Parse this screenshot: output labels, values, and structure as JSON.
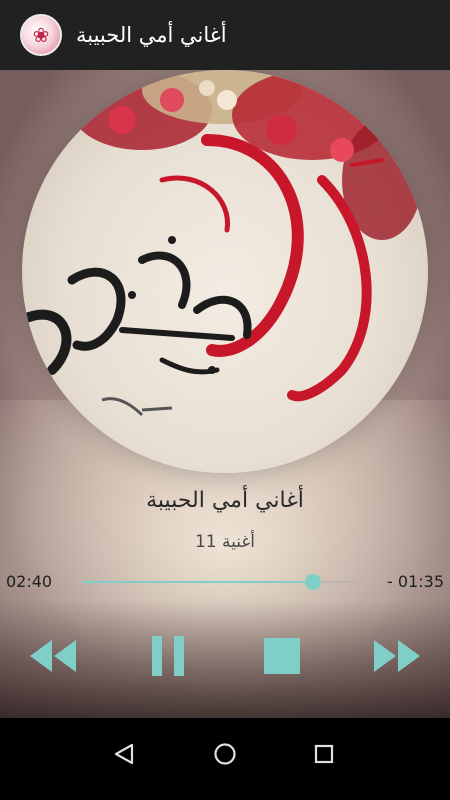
{
  "app_bar": {
    "title": "أغاني أمي الحبيبة",
    "logo_icon": "app-logo-icon"
  },
  "player": {
    "song_title": "أغاني أمي الحبيبة",
    "song_subtitle": "أغنية 11",
    "elapsed": "02:40",
    "remaining": "- 01:35",
    "progress": 0.82,
    "accent_color": "#7fcfc8"
  },
  "controls": {
    "rewind_icon": "rewind-icon",
    "pause_icon": "pause-icon",
    "stop_icon": "stop-icon",
    "fast_forward_icon": "fast-forward-icon"
  },
  "nav": {
    "back_icon": "back-icon",
    "home_icon": "home-icon",
    "recents_icon": "recents-icon"
  }
}
